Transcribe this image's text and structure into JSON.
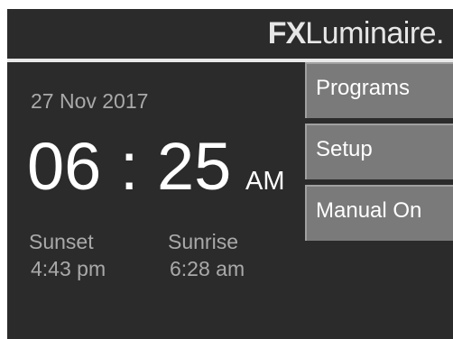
{
  "header": {
    "logo_bold": "FX",
    "logo_regular": "Luminaire."
  },
  "clock": {
    "date": "27 Nov 2017",
    "time": "06 : 25",
    "ampm": "AM"
  },
  "sunset": {
    "label": "Sunset",
    "value": "4:43 pm"
  },
  "sunrise": {
    "label": "Sunrise",
    "value": "6:28 am"
  },
  "menu": {
    "items": [
      {
        "label": "Programs"
      },
      {
        "label": "Setup"
      },
      {
        "label": "Manual On"
      }
    ]
  },
  "colors": {
    "screen_bg": "#2b2b2b",
    "button_bg": "#7a7a7a",
    "text_primary": "#ffffff",
    "text_secondary": "#a9a9a9"
  }
}
